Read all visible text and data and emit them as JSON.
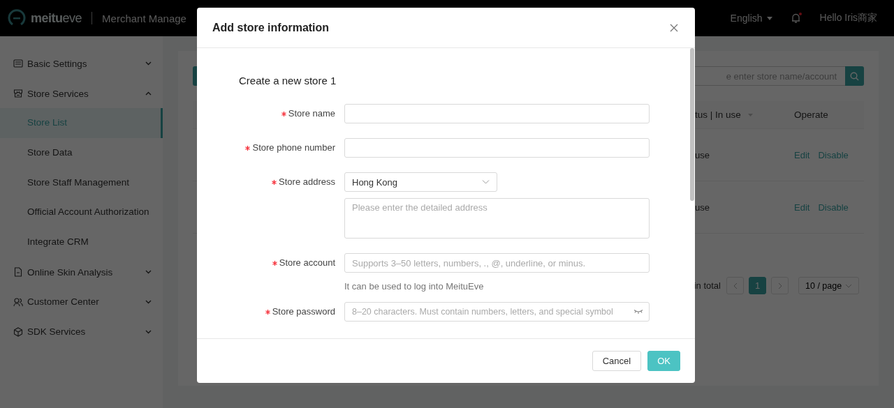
{
  "top_bar": {
    "logo": "**meitu**eve",
    "title": "Merchant Manage",
    "language": "English",
    "notification_dot": true,
    "greeting": "Hello Iris商家"
  },
  "sidebar": {
    "items": [
      {
        "label": "Basic Settings",
        "expanded": false
      },
      {
        "label": "Store Services",
        "expanded": true,
        "children": [
          {
            "label": "Store List",
            "selected": true
          },
          {
            "label": "Store Data",
            "selected": false
          },
          {
            "label": "Store Staff Management",
            "selected": false
          },
          {
            "label": "Official Account Authorization",
            "selected": false
          },
          {
            "label": "Integrate CRM",
            "selected": false
          }
        ]
      },
      {
        "label": "Online Skin Analysis",
        "expanded": false
      },
      {
        "label": "Customer Center",
        "expanded": false
      },
      {
        "label": "SDK Services",
        "expanded": false
      }
    ]
  },
  "search": {
    "placeholder": "e enter store name/account"
  },
  "table": {
    "columns": [
      "tus | In use",
      "Operate"
    ],
    "rows": [
      {
        "status": "use",
        "actions": [
          "Edit",
          "Disable"
        ]
      },
      {
        "status": "use",
        "actions": [
          "Edit",
          "Disable"
        ]
      }
    ]
  },
  "pagination": {
    "total": "in total",
    "pages": [
      {
        "label": "1",
        "selected": true
      }
    ],
    "page_size": "10 / page"
  },
  "dialog": {
    "title": "Add store information",
    "heading": "Create a new store 1",
    "fields": [
      {
        "kind": "input",
        "label": "Store name",
        "required": true
      },
      {
        "kind": "input",
        "label": "Store phone number",
        "required": true
      },
      {
        "kind": "address",
        "label": "Store address",
        "required": true,
        "value": "Hong Kong",
        "placeholder": "Please enter the detailed address"
      },
      {
        "kind": "input",
        "label": "Store account",
        "required": true,
        "placeholder": "Supports 3–50 letters, numbers, ., @, underline, or minus.",
        "hint": "It can be used to log into MeituEve"
      },
      {
        "kind": "password",
        "label": "Store password",
        "required": true,
        "placeholder": "8–20 characters. Must contain numbers, letters, and special symbol"
      }
    ],
    "buttons": [
      {
        "label": "Cancel",
        "kind": "default"
      },
      {
        "label": "OK",
        "kind": "primary"
      }
    ]
  }
}
